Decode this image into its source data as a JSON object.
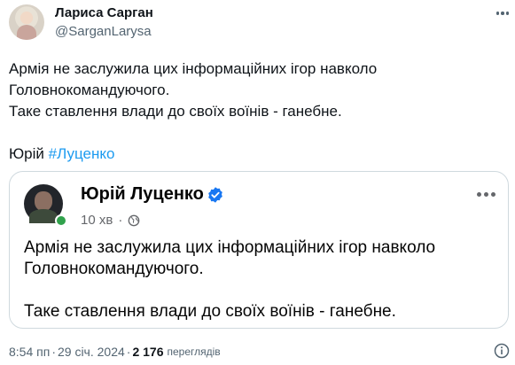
{
  "author": {
    "display_name": "Лариса Сарган",
    "handle": "@SarganLarysa"
  },
  "tweet": {
    "line1": "Армія не заслужила цих інформаційних ігор навколо",
    "line2": "Головнокомандуючого.",
    "line3": "Таке ставлення влади до своїх воїнів - ганебне.",
    "signature_name": "Юрій",
    "hashtag": "#Луценко"
  },
  "quoted_post": {
    "author": "Юрій Луценко",
    "time": "10 хв",
    "meta_separator": "·",
    "line1": "Армія не заслужила цих інформаційних ігор навколо",
    "line2": "Головнокомандуючого.",
    "line3": "Таке ставлення влади до своїх воїнів - ганебне."
  },
  "footer": {
    "time": "8:54 пп",
    "date": "29 січ. 2024",
    "separator": "·",
    "views_count": "2 176",
    "views_label": "переглядів"
  },
  "icons": {
    "verified": "verified-badge-icon",
    "globe": "globe-icon",
    "more": "more-icon",
    "info": "info-icon"
  },
  "colors": {
    "link": "#1d9bf0",
    "text": "#0f1419",
    "secondary": "#536471",
    "verified": "#1877f2",
    "online": "#31a24c",
    "border": "#cfd9de"
  }
}
